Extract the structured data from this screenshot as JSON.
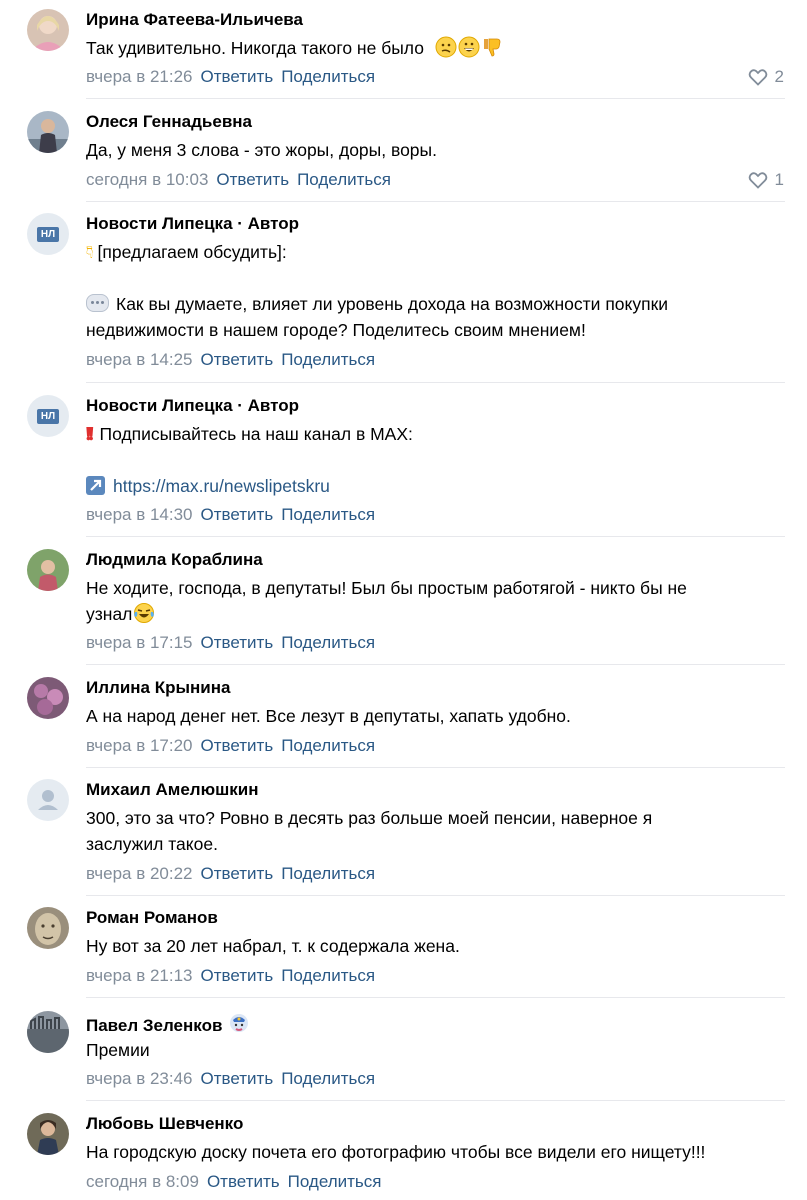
{
  "actions": {
    "reply": "Ответить",
    "share": "Поделиться"
  },
  "comments": [
    {
      "author": "Ирина Фатеева-Ильичева",
      "lines": [
        "Так удивительно. Никогда такого не было"
      ],
      "time": "вчера в 21:26",
      "likes": "2",
      "avatar": "photo"
    },
    {
      "author": "Олеся Геннадьевна",
      "lines": [
        "Да, у меня 3 слова - это жоры, доры, воры."
      ],
      "time": "сегодня в 10:03",
      "likes": "1",
      "avatar": "photo"
    },
    {
      "author": "Новости Липецка · Автор",
      "lines": [
        "[предлагаем обсудить]:",
        "",
        "Как вы думаете, влияет ли уровень дохода на возможности покупки",
        "недвижимости в нашем городе? Поделитесь своим мнением!"
      ],
      "time": "вчера в 14:25",
      "avatar": "НЛ"
    },
    {
      "author": "Новости Липецка · Автор",
      "lines": [
        "Подписывайтесь на наш канал в MAX:",
        "",
        "https://max.ru/newslipetskru"
      ],
      "time": "вчера в 14:30",
      "avatar": "НЛ"
    },
    {
      "author": "Людмила Кораблина",
      "lines": [
        "Не ходите, господа, в депутаты! Был бы простым работягой - никто бы не",
        "узнал"
      ],
      "time": "вчера в 17:15",
      "avatar": "photo"
    },
    {
      "author": "Иллина Крынина",
      "lines": [
        "А на народ денег нет. Все лезут в депутаты, хапать удобно."
      ],
      "time": "вчера в 17:20",
      "avatar": "photo"
    },
    {
      "author": "Михаил Амелюшкин",
      "lines": [
        "300, это за что? Ровно в десять раз больше моей пенсии, наверное я",
        "заслужил такое."
      ],
      "time": "вчера в 20:22",
      "avatar": "placeholder"
    },
    {
      "author": "Роман Романов",
      "lines": [
        "Ну вот за 20 лет набрал, т. к содержала жена."
      ],
      "time": "вчера в 21:13",
      "avatar": "photo"
    },
    {
      "author": "Павел Зеленков",
      "lines": [
        "Премии"
      ],
      "time": "вчера в 23:46",
      "avatar": "photo"
    },
    {
      "author": "Любовь Шевченко",
      "lines": [
        "На городскую доску почета его фотографию чтобы все видели его нищету!!!"
      ],
      "time": "сегодня в 8:09",
      "avatar": "photo"
    }
  ],
  "colors": {
    "link": "#2a5885",
    "meta": "#818c99",
    "divider": "#e7e8ec",
    "group_avatar_bg": "#e5ebf1",
    "group_avatar_fg": "#4a76a8"
  }
}
